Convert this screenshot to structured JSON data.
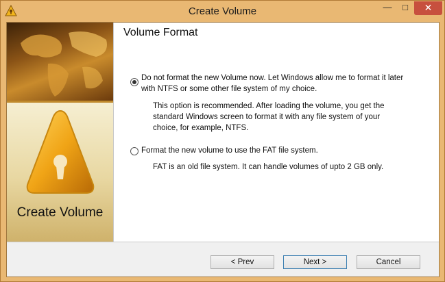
{
  "window": {
    "title": "Create Volume",
    "minimize_glyph": "—",
    "maximize_glyph": "□",
    "close_glyph": "✕"
  },
  "sidebar": {
    "title": "Create Volume",
    "icon": "warning-keyhole-icon"
  },
  "main": {
    "heading": "Volume Format",
    "options": [
      {
        "checked": true,
        "label_line1": "Do not format the new Volume now. Let Windows allow me to format it later",
        "label_line2": "with NTFS or some other file system of my choice.",
        "desc_line1": "This option is recommended. After loading the volume, you get the",
        "desc_line2": "standard Windows screen to format it with any file system of your",
        "desc_line3": "choice, for example, NTFS."
      },
      {
        "checked": false,
        "label_line1": "Format the new volume to use the FAT file system.",
        "desc_line1": "FAT is an old file system. It can handle volumes of upto 2 GB only."
      }
    ]
  },
  "buttons": {
    "prev": "< Prev",
    "next": "Next >",
    "cancel": "Cancel"
  },
  "colors": {
    "frame": "#e9b873",
    "close": "#c7503e"
  }
}
